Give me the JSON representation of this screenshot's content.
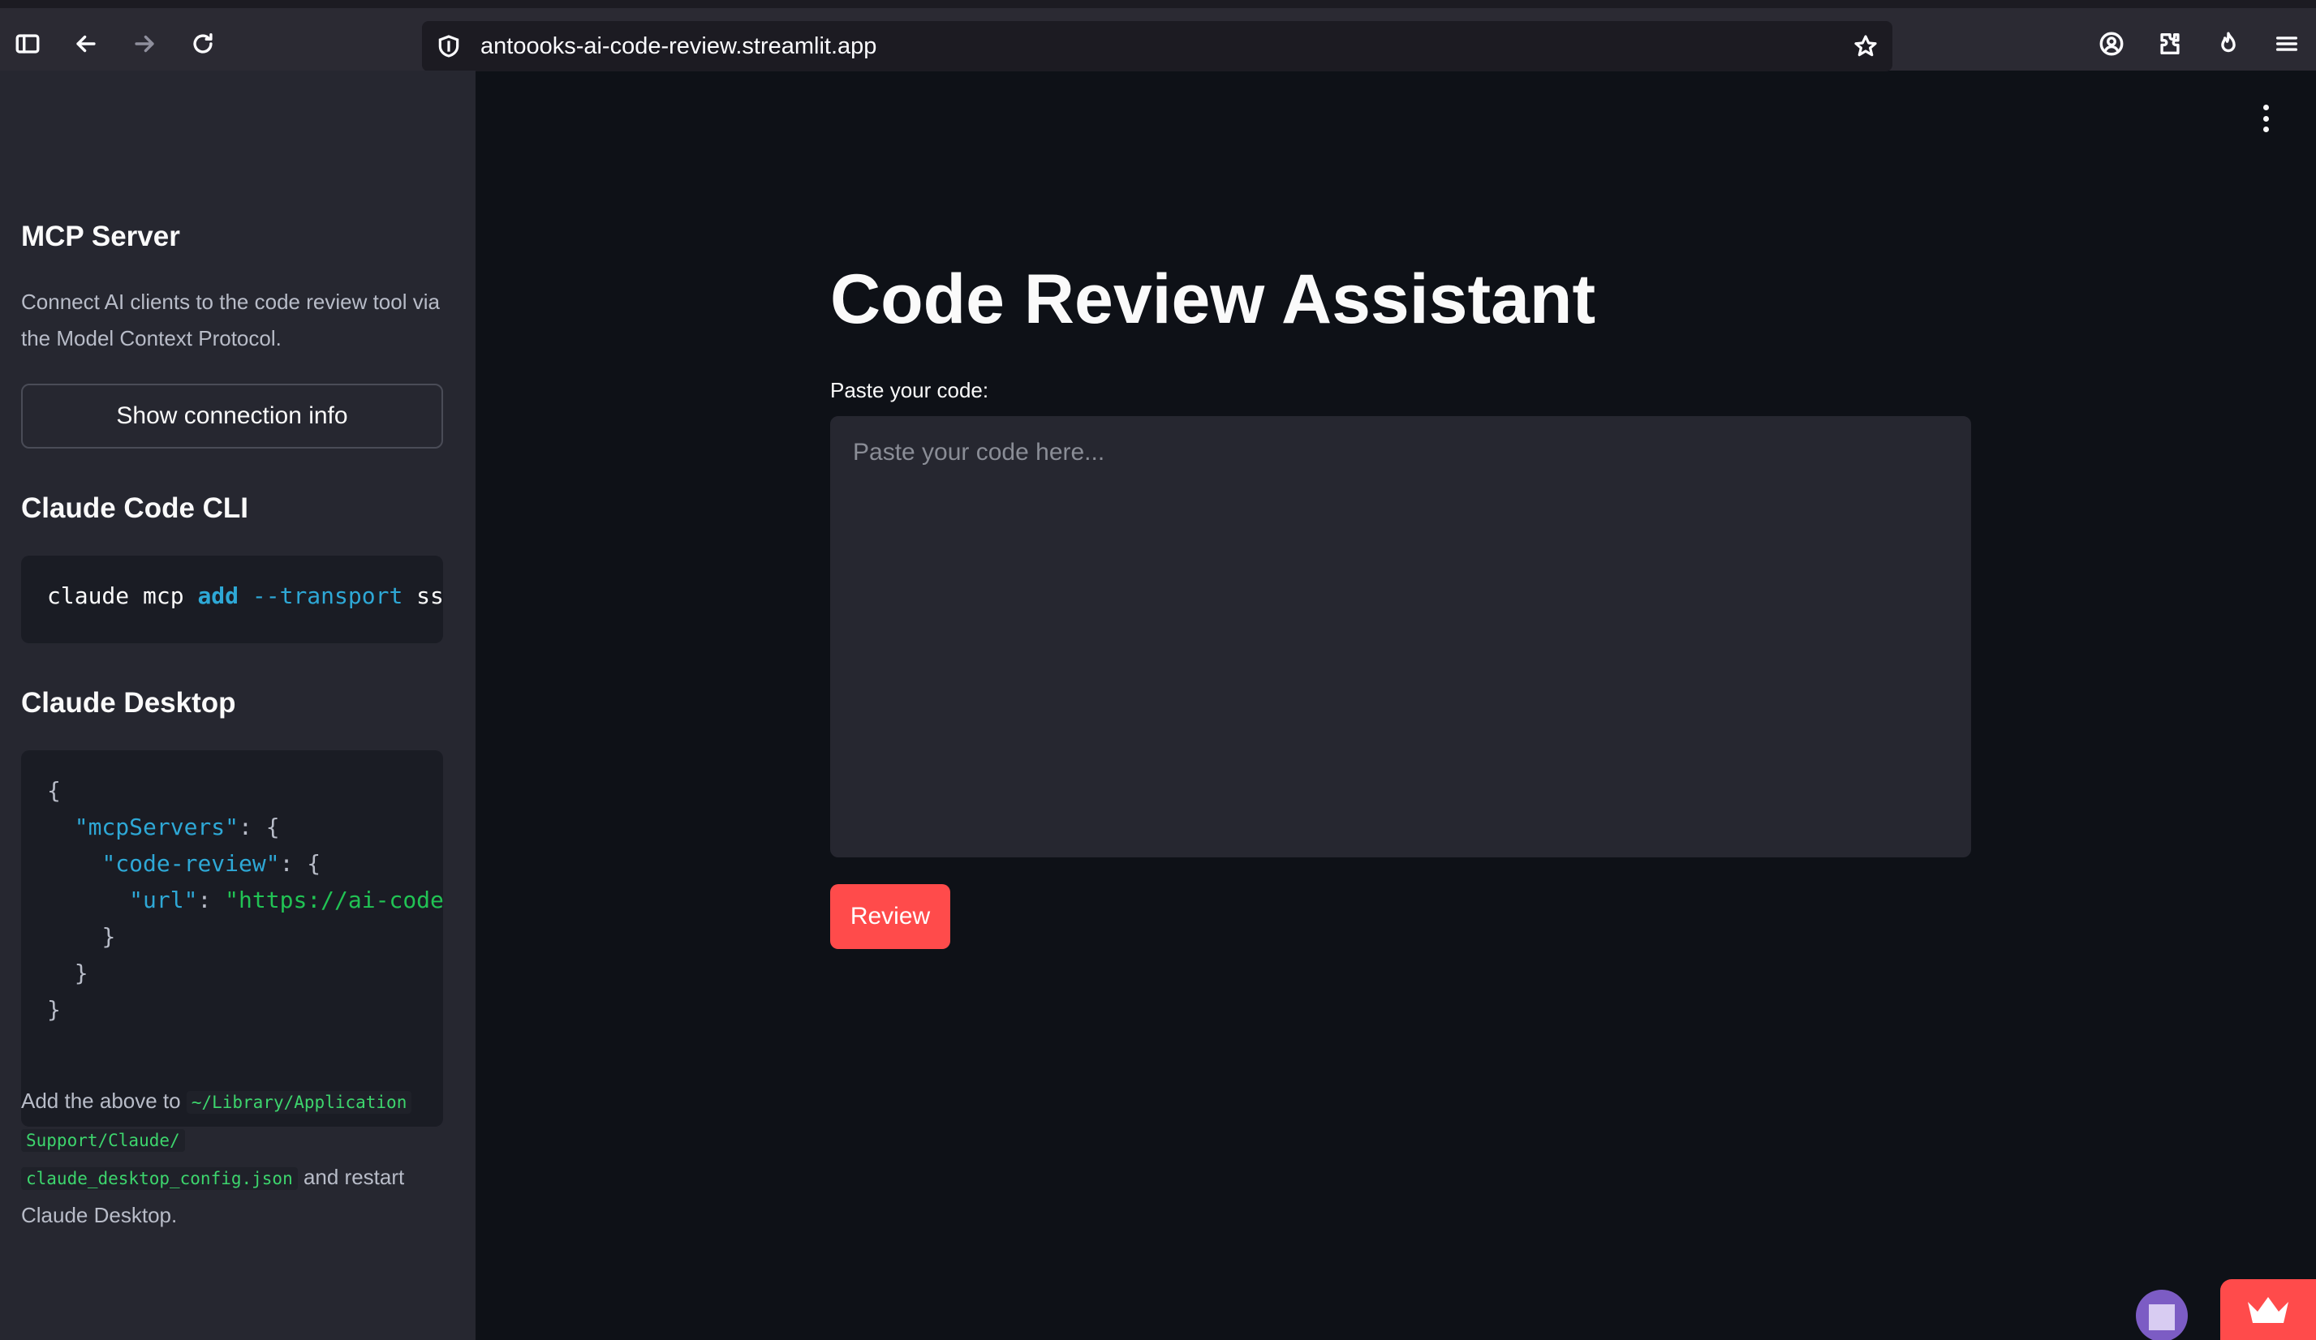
{
  "browser": {
    "url": "antoooks-ai-code-review.streamlit.app"
  },
  "sidebar": {
    "mcp_heading": "MCP Server",
    "mcp_description": "Connect AI clients to the code review tool via the Model Context Protocol.",
    "connection_button": "Show connection info",
    "cli_heading": "Claude Code CLI",
    "cli_command": {
      "cmd": "claude mcp ",
      "sub": "add",
      "flag": "--transport",
      "rest": " ss"
    },
    "desktop_heading": "Claude Desktop",
    "json_config": {
      "open_brace": "{",
      "servers_key": "\"mcpServers\"",
      "review_key": "\"code-review\"",
      "url_key": "\"url\"",
      "url_value": "\"https://ai-code",
      "close_brace": "}"
    },
    "note": {
      "prefix": "Add the above to ",
      "path_1": "~/Library/Application",
      "path_2": "Support/Claude/",
      "path_3": "claude_desktop_config.json",
      "suffix_1": " and restart",
      "suffix_2": "Claude Desktop."
    }
  },
  "main": {
    "title": "Code Review Assistant",
    "code_label": "Paste your code:",
    "code_placeholder": "Paste your code here...",
    "review_button": "Review"
  },
  "colors": {
    "accent": "#ff4b4b",
    "sidebar_bg": "#262730",
    "main_bg": "#0e1117"
  }
}
